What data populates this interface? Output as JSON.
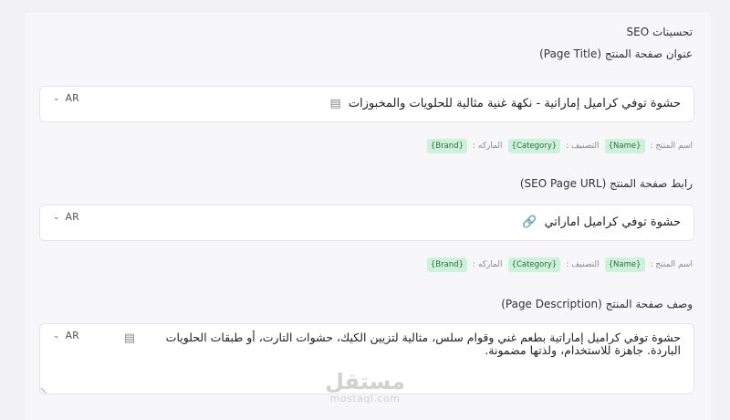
{
  "section": {
    "title": "تحسينات SEO"
  },
  "page_title": {
    "label": "عنوان صفحة المنتج (Page Title)",
    "lang": "AR",
    "value": "حشوة توفي كراميل إماراتية - نكهة غنية مثالية للحلويات والمخبوزات",
    "icon": "copy-icon"
  },
  "tags_row": {
    "name_label": "اسم المنتج :",
    "name_chip": "{Name}",
    "category_label": "التصنيف :",
    "category_chip": "{Category}",
    "brand_label": "الماركه :",
    "brand_chip": "{Brand}"
  },
  "page_url": {
    "label": "رابط صفحة المنتج (SEO Page URL)",
    "lang": "AR",
    "value": "حشوة توفي كراميل اماراتي",
    "icon": "link-icon"
  },
  "page_description": {
    "label": "وصف صفحة المنتج (Page Description)",
    "lang": "AR",
    "value": "حشوة توفي كراميل إماراتية بطعم غني وقوام سلس، مثالية لتزيين الكيك، حشوات التارت، أو طبقات الحلويات الباردة. جاهزة للاستخدام، ولذتها مضمونة.",
    "icon": "document-icon"
  },
  "watermark": {
    "arabic": "مستقل",
    "latin": "mostaql.com"
  }
}
